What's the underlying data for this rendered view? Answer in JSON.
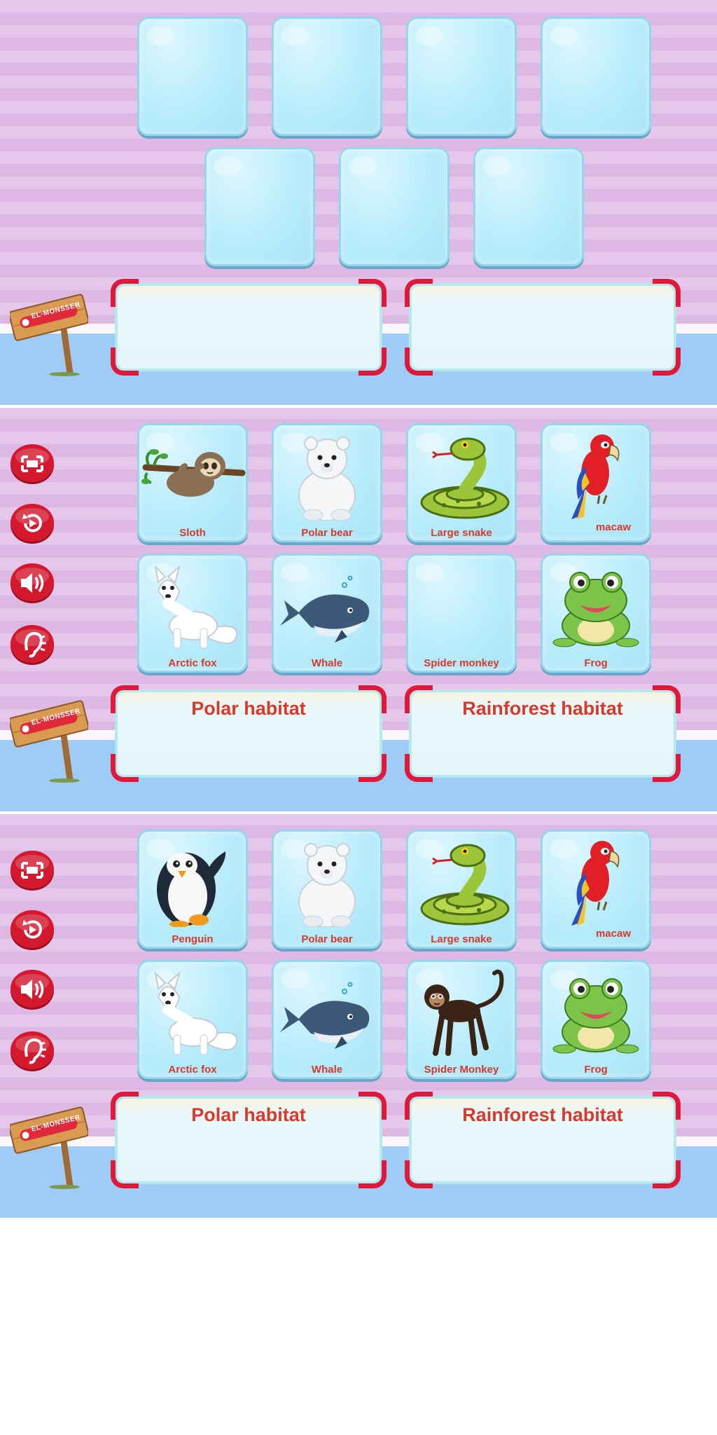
{
  "logo_text": "EL-MONSSER",
  "screens": [
    {
      "cards_top": [
        {
          "label": "",
          "icon": ""
        },
        {
          "label": "",
          "icon": ""
        },
        {
          "label": "",
          "icon": ""
        },
        {
          "label": "",
          "icon": ""
        }
      ],
      "cards_bottom": [
        {
          "label": "",
          "icon": ""
        },
        {
          "label": "",
          "icon": ""
        },
        {
          "label": "",
          "icon": ""
        }
      ],
      "habitats": [
        "",
        ""
      ],
      "show_buttons": false
    },
    {
      "cards_top": [
        {
          "label": "Sloth",
          "icon": "sloth"
        },
        {
          "label": "Polar bear",
          "icon": "polar-bear"
        },
        {
          "label": "Large snake",
          "icon": "snake"
        },
        {
          "label": "macaw",
          "icon": "macaw"
        }
      ],
      "cards_bottom": [
        {
          "label": "Arctic fox",
          "icon": "arctic-fox"
        },
        {
          "label": "Whale",
          "icon": "whale"
        },
        {
          "label": "Spider monkey",
          "icon": ""
        },
        {
          "label": "Frog",
          "icon": "frog"
        }
      ],
      "habitats": [
        "Polar habitat",
        "Rainforest habitat"
      ],
      "show_buttons": true
    },
    {
      "cards_top": [
        {
          "label": "Penguin",
          "icon": "penguin"
        },
        {
          "label": "Polar bear",
          "icon": "polar-bear"
        },
        {
          "label": "Large snake",
          "icon": "snake"
        },
        {
          "label": "macaw",
          "icon": "macaw"
        }
      ],
      "cards_bottom": [
        {
          "label": "Arctic fox",
          "icon": "arctic-fox"
        },
        {
          "label": "Whale",
          "icon": "whale"
        },
        {
          "label": "Spider Monkey",
          "icon": "spider-monkey"
        },
        {
          "label": "Frog",
          "icon": "frog"
        }
      ],
      "habitats": [
        "Polar habitat",
        "Rainforest habitat"
      ],
      "show_buttons": true
    }
  ],
  "side_buttons": [
    {
      "icon": "fullscreen-icon"
    },
    {
      "icon": "restart-icon"
    },
    {
      "icon": "sound-icon"
    },
    {
      "icon": "listen-icon"
    }
  ],
  "colors": {
    "card_label": "#d63a2a",
    "habitat_title": "#d63a2a",
    "button_red": "#d4192f",
    "frame_red": "#e0193a",
    "bg_stripe_a": "#e4c7ea",
    "bg_stripe_b": "#dcb8e3",
    "floor_blue": "#9fcbf7"
  }
}
